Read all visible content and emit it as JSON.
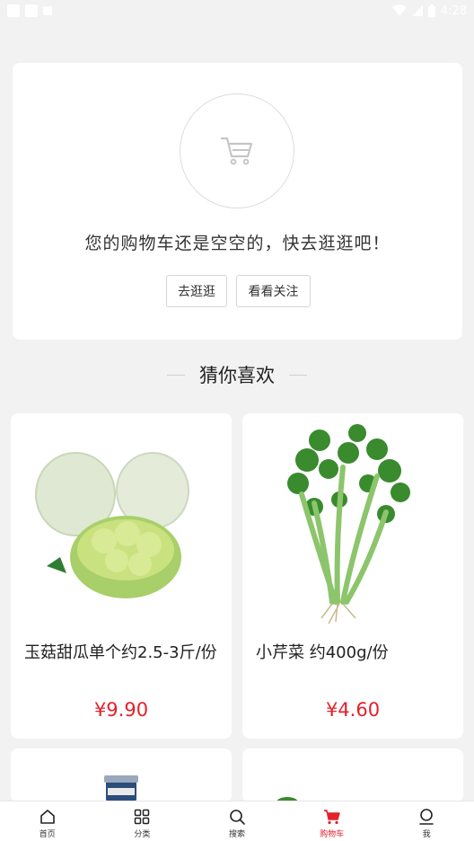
{
  "status_bar": {
    "time": "4:28"
  },
  "empty_cart": {
    "message": "您的购物车还是空空的，快去逛逛吧！",
    "go_shopping_label": "去逛逛",
    "view_follows_label": "看看关注"
  },
  "recommend": {
    "title": "猜你喜欢",
    "products": [
      {
        "name": "玉菇甜瓜单个约2.5-3斤/份",
        "price": "¥9.90"
      },
      {
        "name": "小芹菜 约400g/份",
        "price": "¥4.60"
      }
    ]
  },
  "tabbar": {
    "items": [
      {
        "label": "首页",
        "icon": "home-icon"
      },
      {
        "label": "分类",
        "icon": "grid-icon"
      },
      {
        "label": "搜索",
        "icon": "search-icon"
      },
      {
        "label": "购物车",
        "icon": "cart-icon"
      },
      {
        "label": "我",
        "icon": "user-icon"
      }
    ],
    "active_index": 3,
    "active_color": "#e4202a"
  }
}
